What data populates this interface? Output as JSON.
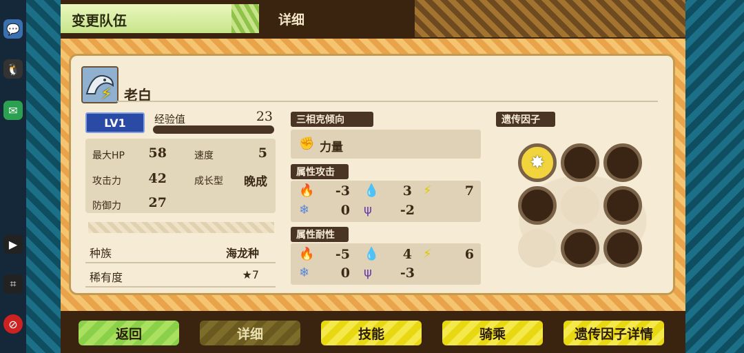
{
  "header": {
    "title": "变更队伍",
    "section": "详细"
  },
  "monster": {
    "name": "老白",
    "level": "LV1",
    "exp_label": "经验值",
    "exp_value": "23",
    "stats": [
      {
        "label": "最大HP",
        "value": "58"
      },
      {
        "label": "速度",
        "value": "5"
      },
      {
        "label": "攻击力",
        "value": "42"
      },
      {
        "label": "成长型",
        "value": "晚成"
      },
      {
        "label": "防御力",
        "value": "27"
      }
    ],
    "species_label": "种族",
    "species_value": "海龙种",
    "rarity_label": "稀有度",
    "rarity_value": "★7"
  },
  "affinity": {
    "title": "三相克倾向",
    "value": "力量",
    "icon": "fist-icon"
  },
  "attack": {
    "title": "属性攻击",
    "fire": "-3",
    "water": "3",
    "thunder": "7",
    "ice": "0",
    "dragon": "-2"
  },
  "resist": {
    "title": "属性耐性",
    "fire": "-5",
    "water": "4",
    "thunder": "6",
    "ice": "0",
    "dragon": "-3"
  },
  "genes": {
    "title": "遗传因子",
    "slots": [
      "active",
      "dark",
      "dark",
      "dark",
      "empty",
      "dark",
      "empty",
      "dark",
      "dark"
    ]
  },
  "buttons": {
    "back": "返回",
    "detail": "详细",
    "skills": "技能",
    "ride": "骑乘",
    "gene_detail": "遗传因子详情"
  },
  "colors": {
    "accent_green": "#a9e060",
    "accent_yellow": "#f4e84a",
    "frame_orange": "#e9a34a",
    "panel": "#f6ecd5"
  }
}
